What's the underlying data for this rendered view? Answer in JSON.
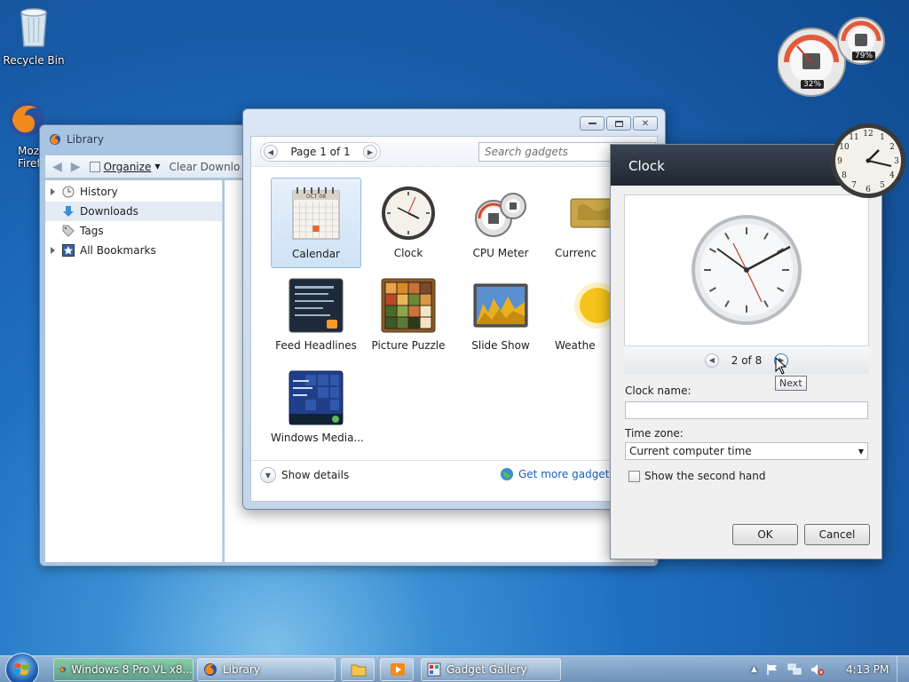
{
  "desktop": {
    "recycle_bin_label": "Recycle Bin",
    "firefox_label_1": "Moz",
    "firefox_label_2": "Firef"
  },
  "library": {
    "title": "Library",
    "organize_label": "Organize",
    "clear_downloads_label": "Clear Downlo",
    "sidebar": [
      {
        "label": "History",
        "icon": "clock-icon",
        "expandable": true
      },
      {
        "label": "Downloads",
        "icon": "download-arrow-icon",
        "expandable": false,
        "selected": true
      },
      {
        "label": "Tags",
        "icon": "tag-icon",
        "expandable": false
      },
      {
        "label": "All Bookmarks",
        "icon": "star-icon",
        "expandable": true
      }
    ]
  },
  "gallery": {
    "page_label": "Page 1 of 1",
    "search_placeholder": "Search gadgets",
    "gadgets": [
      {
        "label": "Calendar",
        "icon": "calendar-icon",
        "selected": true
      },
      {
        "label": "Clock",
        "icon": "clock-icon"
      },
      {
        "label": "CPU Meter",
        "icon": "cpu-meter-icon"
      },
      {
        "label": "Currenc",
        "icon": "currency-icon"
      },
      {
        "label": "Feed Headlines",
        "icon": "feed-headlines-icon"
      },
      {
        "label": "Picture Puzzle",
        "icon": "picture-puzzle-icon"
      },
      {
        "label": "Slide Show",
        "icon": "slide-show-icon"
      },
      {
        "label": "Weathe",
        "icon": "weather-icon"
      },
      {
        "label": "Windows Media...",
        "icon": "windows-media-icon"
      }
    ],
    "calendar_month": "OCT 08",
    "calendar_highlight_day": "24",
    "show_details_label": "Show details",
    "get_more_label": "Get more gadgets o"
  },
  "clock_dialog": {
    "title": "Clock",
    "pager_label": "2 of 8",
    "next_tooltip": "Next",
    "clock_name_label": "Clock name:",
    "clock_name_value": "",
    "time_zone_label": "Time zone:",
    "time_zone_value": "Current computer time",
    "second_hand_label": "Show the second hand",
    "second_hand_checked": false,
    "ok_label": "OK",
    "cancel_label": "Cancel"
  },
  "desktop_gadgets": {
    "cpu_percent": "32%",
    "memory_percent": "79%"
  },
  "taskbar": {
    "items": [
      {
        "label": "Windows 8 Pro VL x8...",
        "icon": "firefox-icon"
      },
      {
        "label": "Library",
        "icon": "firefox-icon"
      },
      {
        "label": "Gadget Gallery",
        "icon": "gadget-gallery-icon"
      }
    ],
    "time": "4:13 PM"
  }
}
